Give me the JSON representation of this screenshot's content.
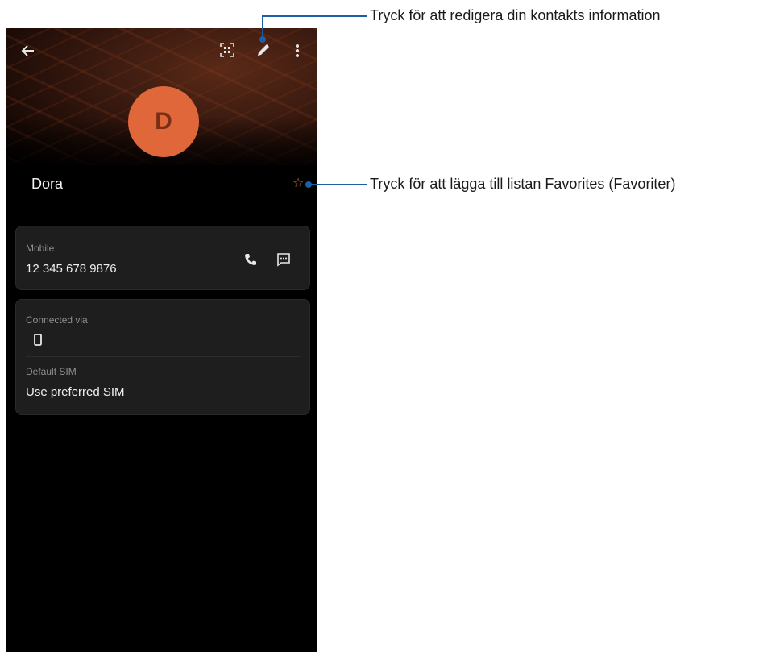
{
  "header": {
    "back_icon": "arrow-left-icon",
    "qr_icon": "qr-code-icon",
    "edit_icon": "pencil-icon",
    "more_icon": "more-vert-icon"
  },
  "contact": {
    "initial": "D",
    "name": "Dora",
    "avatar_color": "#e0673a",
    "favorite_icon": "star-outline-icon"
  },
  "mobile_card": {
    "label": "Mobile",
    "number": "12 345 678 9876",
    "call_icon": "phone-icon",
    "message_icon": "message-icon"
  },
  "sim_card": {
    "connected_label": "Connected via",
    "device_icon": "smartphone-icon",
    "default_sim_label": "Default SIM",
    "default_sim_value": "Use preferred SIM"
  },
  "annotations": {
    "edit_callout": "Tryck för att redigera din kontakts information",
    "favorite_callout": "Tryck för att lägga till listan Favorites (Favoriter)",
    "line_color": "#1d5fa5"
  }
}
